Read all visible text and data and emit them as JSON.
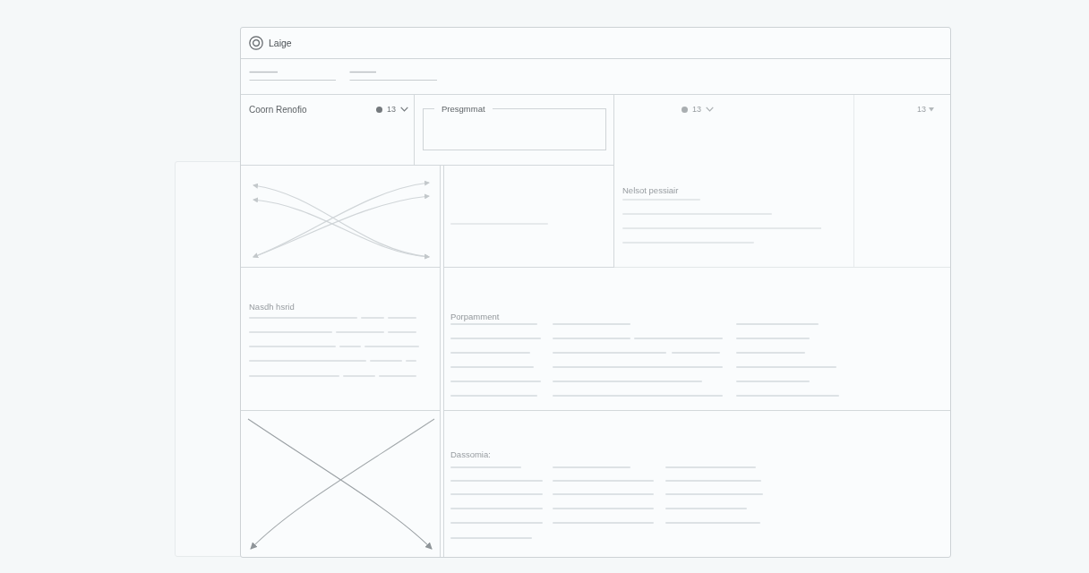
{
  "window": {
    "title": "Laige"
  },
  "summary_panel": {
    "title": "Coorn Renofio",
    "dropdown": "13"
  },
  "group_box": {
    "legend": "Presgmmat"
  },
  "detail_panel": {
    "dropdown": "13",
    "heading": "Nelsot pessiair"
  },
  "side_panel": {
    "dropdown": "13"
  },
  "text_panel": {
    "heading": "Nasdh hsrid"
  },
  "tables": [
    {
      "heading": "Porpamment"
    },
    {
      "heading": "Dassomia:"
    }
  ]
}
